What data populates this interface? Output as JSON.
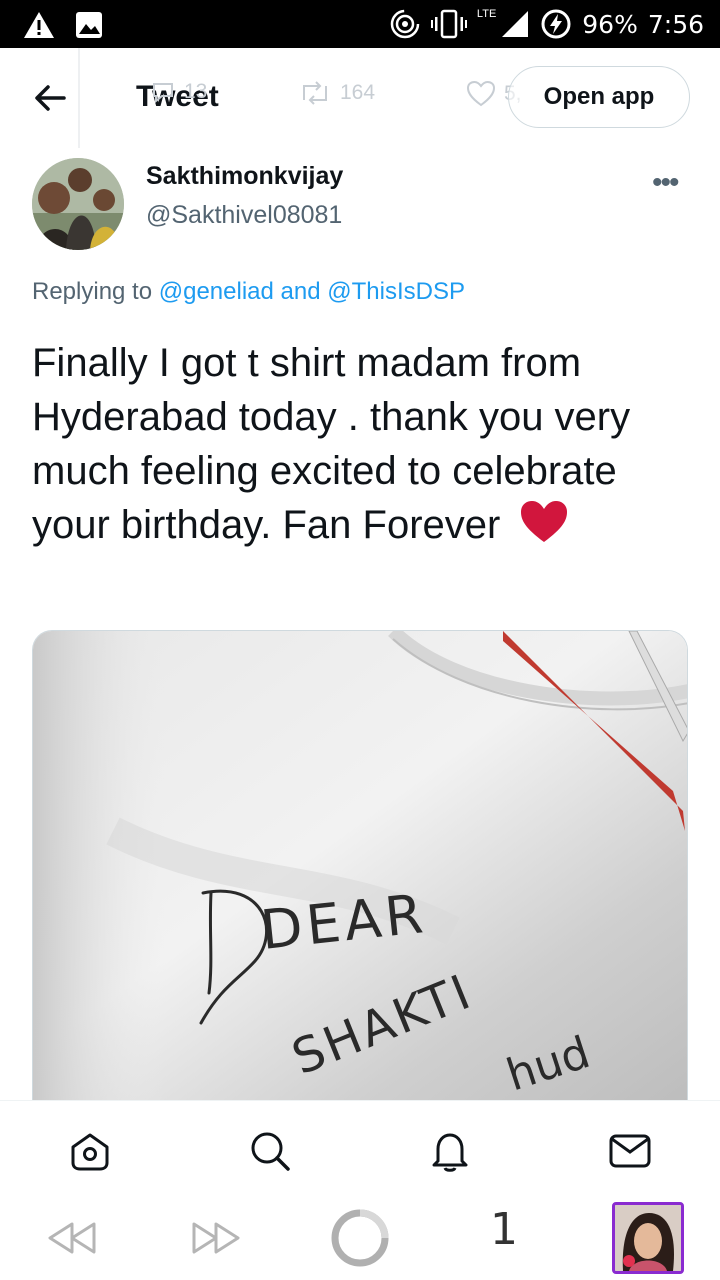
{
  "status_bar": {
    "battery": "96%",
    "time": "7:56",
    "network": "LTE",
    "icons": [
      "alert-icon",
      "image-icon",
      "hotspot-icon",
      "vibrate-icon",
      "signal-icon",
      "battery-saver-icon"
    ]
  },
  "header": {
    "title": "Tweet",
    "open_app_label": "Open app",
    "retweets_partial": "164",
    "likes_partial": "5,",
    "replies_partial": "13"
  },
  "author": {
    "name": "Sakthimonkvijay",
    "handle": "@Sakthivel08081"
  },
  "reply": {
    "prefix": "Replying to ",
    "mention1": "@geneliad",
    "conjunction": " and ",
    "mention2": "@ThisIsDSP"
  },
  "tweet": {
    "text": "Finally I got t shirt madam from Hyderabad today . thank you very much feeling excited to celebrate your birthday. Fan Forever",
    "emoji": "heart"
  },
  "media": {
    "handwriting_line1": "DEAR",
    "handwriting_line2": "SHAKTI",
    "handwriting_line3": "hud"
  },
  "tabs": [
    "home-icon",
    "search-icon",
    "notifications-icon",
    "messages-icon"
  ],
  "browser_nav": {
    "tab_count": "1"
  },
  "colors": {
    "link": "#1d9bf0",
    "heart": "#d1163d",
    "secondary_text": "#536471",
    "profile_border": "#8a2bd0"
  }
}
